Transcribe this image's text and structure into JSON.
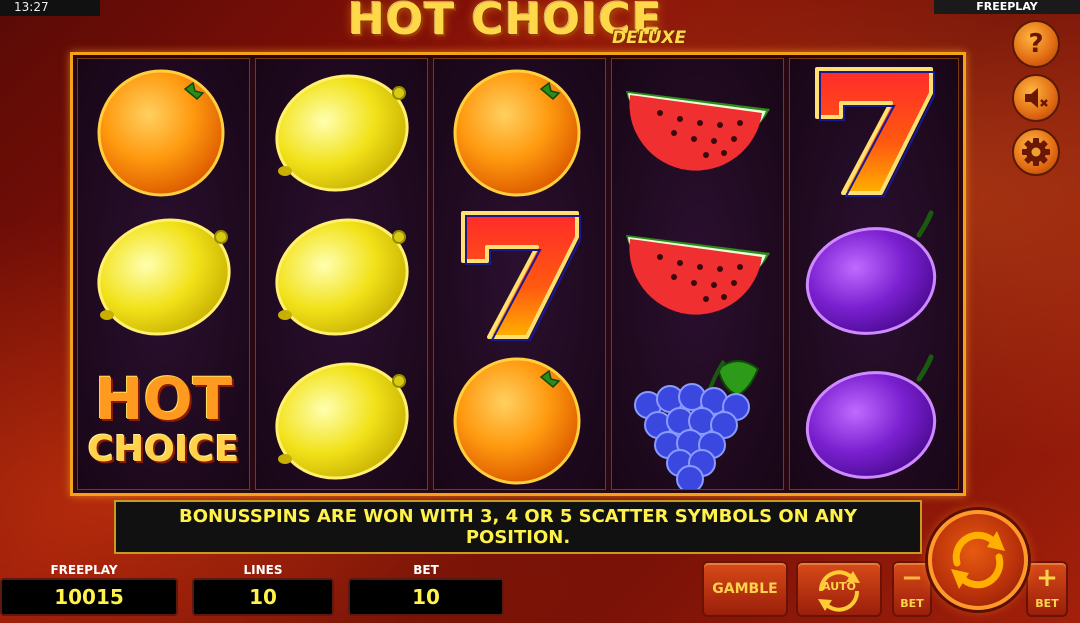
{
  "status": {
    "time": "13:27",
    "mode": "FREEPLAY"
  },
  "logo": {
    "main": "HOT CHOICE",
    "sub": "DELUXE"
  },
  "reels": [
    [
      "orange",
      "lemon",
      "hot-choice"
    ],
    [
      "lemon",
      "lemon",
      "lemon"
    ],
    [
      "orange",
      "seven",
      "orange"
    ],
    [
      "watermelon",
      "watermelon",
      "grapes"
    ],
    [
      "seven",
      "plum",
      "plum"
    ]
  ],
  "scatter_text": {
    "line1": "HOT",
    "line2": "CHOICE"
  },
  "info": {
    "line1": "BONUSSPINS ARE WON WITH 3, 4 OR 5 SCATTER SYMBOLS ON ANY",
    "line2": "POSITION."
  },
  "stats": {
    "freeplay": {
      "label": "FREEPLAY",
      "value": "10015"
    },
    "lines": {
      "label": "LINES",
      "value": "10"
    },
    "bet": {
      "label": "BET",
      "value": "10"
    }
  },
  "buttons": {
    "gamble": "GAMBLE",
    "auto": "AUTO",
    "bet_minus_sign": "−",
    "bet_minus_label": "BET",
    "bet_plus_sign": "+",
    "bet_plus_label": "BET",
    "help": "?"
  },
  "icons": [
    "help-icon",
    "sound-muted-icon",
    "settings-gear-icon",
    "spin-arrows-icon",
    "auto-arrows-icon"
  ],
  "colors": {
    "accent_gold": "#f3a21a",
    "info_text": "#fff24a",
    "background_red": "#8c1208"
  }
}
